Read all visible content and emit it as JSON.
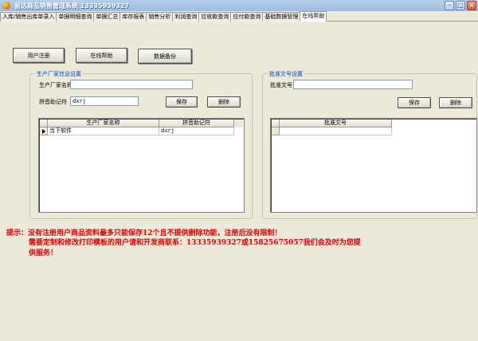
{
  "window": {
    "title": "易达商品销售管理系统 13335939327",
    "minimize": "–",
    "maximize": "□",
    "close": "×"
  },
  "tabs": [
    {
      "label": "入库/销售出库单录入"
    },
    {
      "label": "单据明细查询"
    },
    {
      "label": "单据汇总"
    },
    {
      "label": "库存报表"
    },
    {
      "label": "销售分析"
    },
    {
      "label": "利润查询"
    },
    {
      "label": "应收款查询"
    },
    {
      "label": "应付款查询"
    },
    {
      "label": "基础数据管理"
    },
    {
      "label": "在线帮助"
    }
  ],
  "toolbar": {
    "register_label": "用户注册",
    "help_label": "在线帮助",
    "backup_label": "数据备份"
  },
  "manufacturer": {
    "legend": "生产厂家信息设置",
    "name_label": "生产厂家名称",
    "name_value": "",
    "pinyin_label": "拼音助记符",
    "pinyin_value": "dxrj",
    "save_label": "保存",
    "delete_label": "删除",
    "table": {
      "columns": [
        "生产厂家名称",
        "拼音助记符"
      ],
      "rows": [
        {
          "name": "当下软件",
          "pinyin": "dxrj"
        }
      ]
    }
  },
  "approval": {
    "legend": "批准文号设置",
    "number_label": "批准文号",
    "number_value": "",
    "save_label": "保存",
    "delete_label": "删除",
    "table": {
      "columns": [
        "批准文号"
      ]
    }
  },
  "notice": {
    "line1": "提示：没有注册用户商品资料最多只能保存12个且不提供删除功能，注册后没有限制！",
    "line2": "需要定制和修改打印模板的用户请和开发商联系：13335939327或15825675057我们会及时为您提",
    "line3": "供服务！"
  },
  "colors": {
    "accent": "#0046d5",
    "notice": "#e00000",
    "titlebar": "#9bbce2"
  }
}
